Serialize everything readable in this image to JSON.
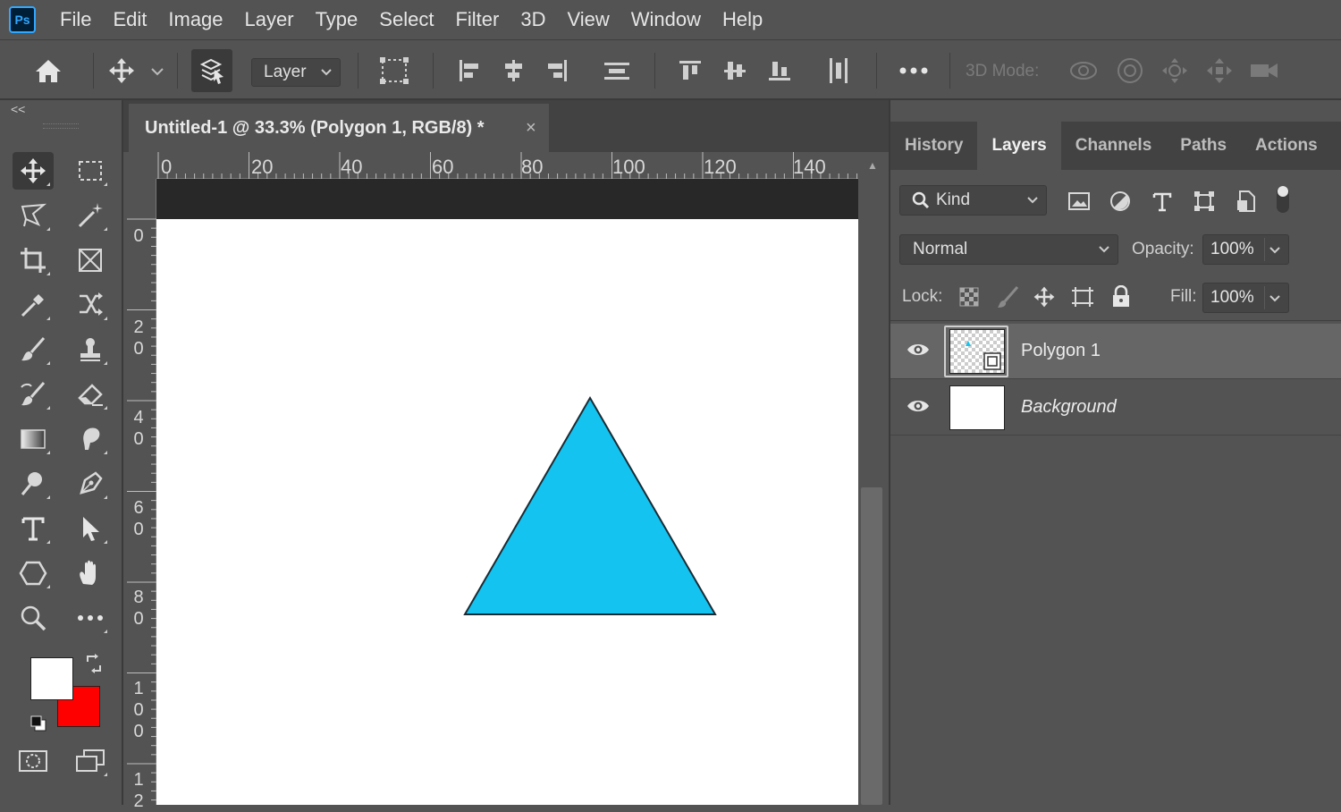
{
  "app": {
    "logo_text": "Ps"
  },
  "menu": [
    "File",
    "Edit",
    "Image",
    "Layer",
    "Type",
    "Select",
    "Filter",
    "3D",
    "View",
    "Window",
    "Help"
  ],
  "options_bar": {
    "auto_select_target": "Layer",
    "mode_label": "3D Mode:"
  },
  "toolbar": {
    "collapse_label": "<<",
    "foreground_color": "#ffffff",
    "background_color": "#ff0000"
  },
  "document": {
    "tab_title": "Untitled-1 @ 33.3% (Polygon 1, RGB/8) *",
    "close_glyph": "×",
    "canvas_color": "#ffffff",
    "shape_fill": "#14c3f0"
  },
  "rulers": {
    "horizontal": [
      "0",
      "20",
      "40",
      "60",
      "80",
      "100",
      "120",
      "140"
    ],
    "vertical": [
      "0",
      "2\n0",
      "4\n0",
      "6\n0",
      "8\n0",
      "1\n0\n0",
      "1\n2"
    ]
  },
  "panel": {
    "tabs": [
      "History",
      "Layers",
      "Channels",
      "Paths",
      "Actions"
    ],
    "active_tab": "Layers",
    "filter_kind": "Kind",
    "blend_mode": "Normal",
    "opacity_label": "Opacity:",
    "opacity_value": "100%",
    "lock_label": "Lock:",
    "fill_label": "Fill:",
    "fill_value": "100%",
    "layers": [
      {
        "name": "Polygon 1",
        "selected": true,
        "visible": true
      },
      {
        "name": "Background",
        "selected": false,
        "visible": true
      }
    ]
  }
}
